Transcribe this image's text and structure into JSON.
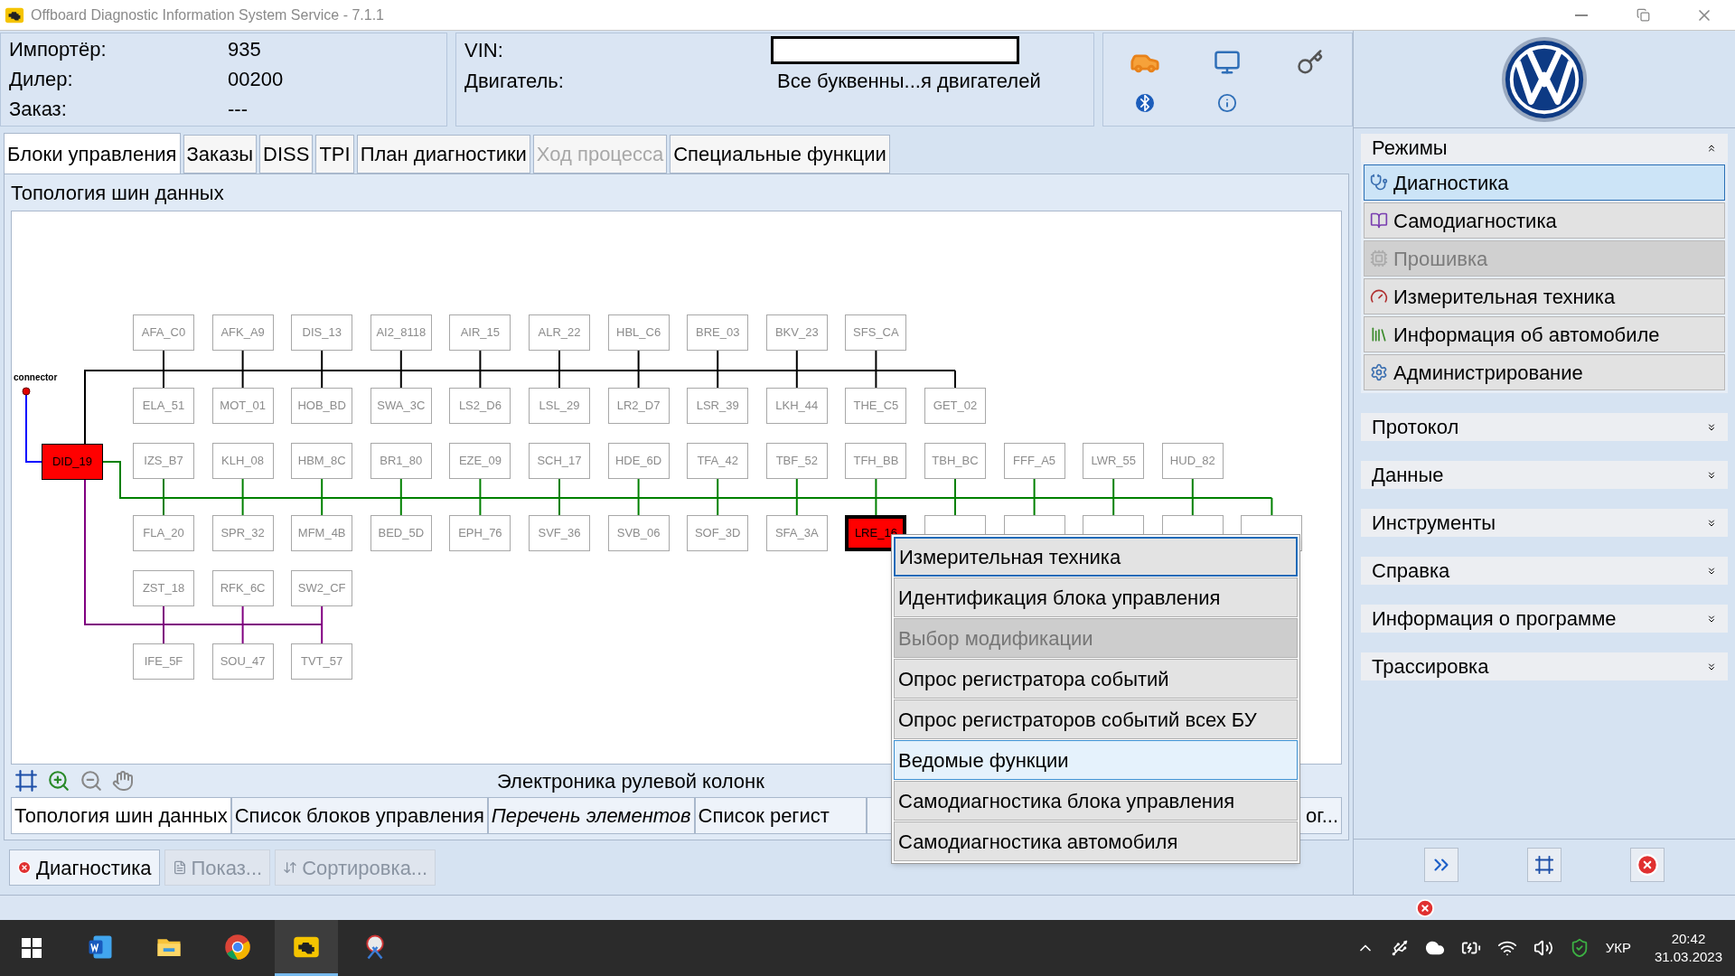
{
  "window": {
    "title": "Offboard Diagnostic Information System Service - 7.1.1"
  },
  "vehicle_info": {
    "fields": [
      {
        "label": "Импортёр:",
        "value": "935"
      },
      {
        "label": "Дилер:",
        "value": "00200"
      },
      {
        "label": "Заказ:",
        "value": "---"
      }
    ]
  },
  "vehicle_id": {
    "vin_label": "VIN:",
    "engine_label": "Двигатель:",
    "engine_value": "Все буквенны...я двигателей"
  },
  "tabs": [
    {
      "label": "Блоки управления",
      "selected": true,
      "disabled": false
    },
    {
      "label": "Заказы",
      "selected": false,
      "disabled": false
    },
    {
      "label": "DISS",
      "selected": false,
      "disabled": false
    },
    {
      "label": "TPI",
      "selected": false,
      "disabled": false
    },
    {
      "label": "План диагностики",
      "selected": false,
      "disabled": false
    },
    {
      "label": "Ход процесса",
      "selected": false,
      "disabled": true
    },
    {
      "label": "Специальные функции",
      "selected": false,
      "disabled": false
    }
  ],
  "panel": {
    "title": "Топология шин данных"
  },
  "topology": {
    "connector": {
      "label": "connector"
    },
    "gateway": {
      "label": "DID_19",
      "fault": true,
      "selected": false
    },
    "buses": [
      {
        "color": "#000000",
        "above": [
          {
            "label": "AFA_C0",
            "fault": false,
            "selected": false
          },
          {
            "label": "AFK_A9",
            "fault": false,
            "selected": false
          },
          {
            "label": "DIS_13",
            "fault": false,
            "selected": false
          },
          {
            "label": "AI2_8118",
            "fault": false,
            "selected": false
          },
          {
            "label": "AIR_15",
            "fault": false,
            "selected": false
          },
          {
            "label": "ALR_22",
            "fault": false,
            "selected": false
          },
          {
            "label": "HBL_C6",
            "fault": false,
            "selected": false
          },
          {
            "label": "BRE_03",
            "fault": false,
            "selected": false
          },
          {
            "label": "BKV_23",
            "fault": false,
            "selected": false
          },
          {
            "label": "SFS_CA",
            "fault": false,
            "selected": false
          }
        ],
        "below": [
          {
            "label": "ELA_51",
            "fault": false,
            "selected": false
          },
          {
            "label": "MOT_01",
            "fault": false,
            "selected": false
          },
          {
            "label": "HOB_BD",
            "fault": false,
            "selected": false
          },
          {
            "label": "SWA_3C",
            "fault": false,
            "selected": false
          },
          {
            "label": "LS2_D6",
            "fault": false,
            "selected": false
          },
          {
            "label": "LSL_29",
            "fault": false,
            "selected": false
          },
          {
            "label": "LR2_D7",
            "fault": false,
            "selected": false
          },
          {
            "label": "LSR_39",
            "fault": false,
            "selected": false
          },
          {
            "label": "LKH_44",
            "fault": false,
            "selected": false
          },
          {
            "label": "THE_C5",
            "fault": false,
            "selected": false
          },
          {
            "label": "GET_02",
            "fault": false,
            "selected": false
          }
        ]
      },
      {
        "color": "#008000",
        "above": [
          {
            "label": "IZS_B7",
            "fault": false,
            "selected": false
          },
          {
            "label": "KLH_08",
            "fault": false,
            "selected": false
          },
          {
            "label": "HBM_8C",
            "fault": false,
            "selected": false
          },
          {
            "label": "BR1_80",
            "fault": false,
            "selected": false
          },
          {
            "label": "EZE_09",
            "fault": false,
            "selected": false
          },
          {
            "label": "SCH_17",
            "fault": false,
            "selected": false
          },
          {
            "label": "HDE_6D",
            "fault": false,
            "selected": false
          },
          {
            "label": "TFA_42",
            "fault": false,
            "selected": false
          },
          {
            "label": "TBF_52",
            "fault": false,
            "selected": false
          },
          {
            "label": "TFH_BB",
            "fault": false,
            "selected": false
          },
          {
            "label": "TBH_BC",
            "fault": false,
            "selected": false
          },
          {
            "label": "FFF_A5",
            "fault": false,
            "selected": false
          },
          {
            "label": "LWR_55",
            "fault": false,
            "selected": false
          },
          {
            "label": "HUD_82",
            "fault": false,
            "selected": false
          }
        ],
        "below": [
          {
            "label": "FLA_20",
            "fault": false,
            "selected": false
          },
          {
            "label": "SPR_32",
            "fault": false,
            "selected": false
          },
          {
            "label": "MFM_4B",
            "fault": false,
            "selected": false
          },
          {
            "label": "BED_5D",
            "fault": false,
            "selected": false
          },
          {
            "label": "EPH_76",
            "fault": false,
            "selected": false
          },
          {
            "label": "SVF_36",
            "fault": false,
            "selected": false
          },
          {
            "label": "SVB_06",
            "fault": false,
            "selected": false
          },
          {
            "label": "SOF_3D",
            "fault": false,
            "selected": false
          },
          {
            "label": "SFA_3A",
            "fault": false,
            "selected": false
          },
          {
            "label": "LRE_16",
            "fault": true,
            "selected": true
          },
          {
            "fault": false,
            "selected": false
          },
          {
            "fault": false,
            "selected": false
          },
          {
            "fault": false,
            "selected": false
          },
          {
            "fault": false,
            "selected": false
          },
          {
            "fault": false,
            "selected": false
          }
        ]
      },
      {
        "color": "#800080",
        "above": [
          {
            "label": "ZST_18",
            "fault": false,
            "selected": false
          },
          {
            "label": "RFK_6C",
            "fault": false,
            "selected": false
          },
          {
            "label": "SW2_CF",
            "fault": false,
            "selected": false
          }
        ],
        "below": [
          {
            "label": "IFE_5F",
            "fault": false,
            "selected": false
          },
          {
            "label": "SOU_47",
            "fault": false,
            "selected": false
          },
          {
            "label": "TVT_57",
            "fault": false,
            "selected": false
          }
        ]
      }
    ]
  },
  "diagram_toolbar": {
    "caption": "Электроника рулевой колонк"
  },
  "view_tabs": [
    {
      "label": "Топология шин данных",
      "selected": true,
      "italic": false
    },
    {
      "label": "Список блоков управления",
      "selected": false,
      "italic": false
    },
    {
      "label": "Перечень элементов",
      "selected": false,
      "italic": true
    },
    {
      "label": "Список регист",
      "selected": false,
      "italic": false
    },
    {
      "label": "ог...",
      "selected": false,
      "italic": false
    }
  ],
  "actions": [
    {
      "label": "Диагностика",
      "disabled": false
    },
    {
      "label": "Показ...",
      "disabled": true
    },
    {
      "label": "Сортировка...",
      "disabled": true
    }
  ],
  "context_menu": [
    {
      "label": "Измерительная техника",
      "disabled": false,
      "focused": true,
      "selected": false
    },
    {
      "label": "Идентификация блока управления",
      "disabled": false,
      "focused": false,
      "selected": false
    },
    {
      "label": "Выбор модификации",
      "disabled": true,
      "focused": false,
      "selected": false
    },
    {
      "label": "Опрос регистратора событий",
      "disabled": false,
      "focused": false,
      "selected": false
    },
    {
      "label": "Опрос регистраторов событий всех БУ",
      "disabled": false,
      "focused": false,
      "selected": false
    },
    {
      "label": "Ведомые функции",
      "disabled": false,
      "focused": false,
      "selected": true
    },
    {
      "label": "Самодиагностика блока управления",
      "disabled": false,
      "focused": false,
      "selected": false
    },
    {
      "label": "Самодиагностика автомобиля",
      "disabled": false,
      "focused": false,
      "selected": false
    }
  ],
  "sidebar": {
    "sections": [
      {
        "title": "Режимы",
        "expanded": true,
        "items": [
          {
            "kind": "diagnosis",
            "label": "Диагностика",
            "selected": true,
            "disabled": false
          },
          {
            "kind": "selftest",
            "label": "Самодиагностика",
            "selected": false,
            "disabled": false
          },
          {
            "kind": "flash",
            "label": "Прошивка",
            "selected": false,
            "disabled": true
          },
          {
            "kind": "measure",
            "label": "Измерительная техника",
            "selected": false,
            "disabled": false
          },
          {
            "kind": "info",
            "label": "Информация об автомобиле",
            "selected": false,
            "disabled": false
          },
          {
            "kind": "admin",
            "label": "Администрирование",
            "selected": false,
            "disabled": false
          }
        ]
      },
      {
        "title": "Протокол",
        "expanded": false
      },
      {
        "title": "Данные",
        "expanded": false
      },
      {
        "title": "Инструменты",
        "expanded": false
      },
      {
        "title": "Справка",
        "expanded": false
      },
      {
        "title": "Информация о программе",
        "expanded": false
      },
      {
        "title": "Трассировка",
        "expanded": false
      }
    ]
  },
  "taskbar": {
    "apps": [
      {
        "kind": "word",
        "selected": false
      },
      {
        "kind": "explorer",
        "selected": false
      },
      {
        "kind": "chrome",
        "selected": false
      },
      {
        "kind": "odis",
        "selected": true
      },
      {
        "kind": "snip",
        "selected": false
      }
    ],
    "language": "УКР",
    "time": "20:42",
    "date": "31.03.2023"
  }
}
